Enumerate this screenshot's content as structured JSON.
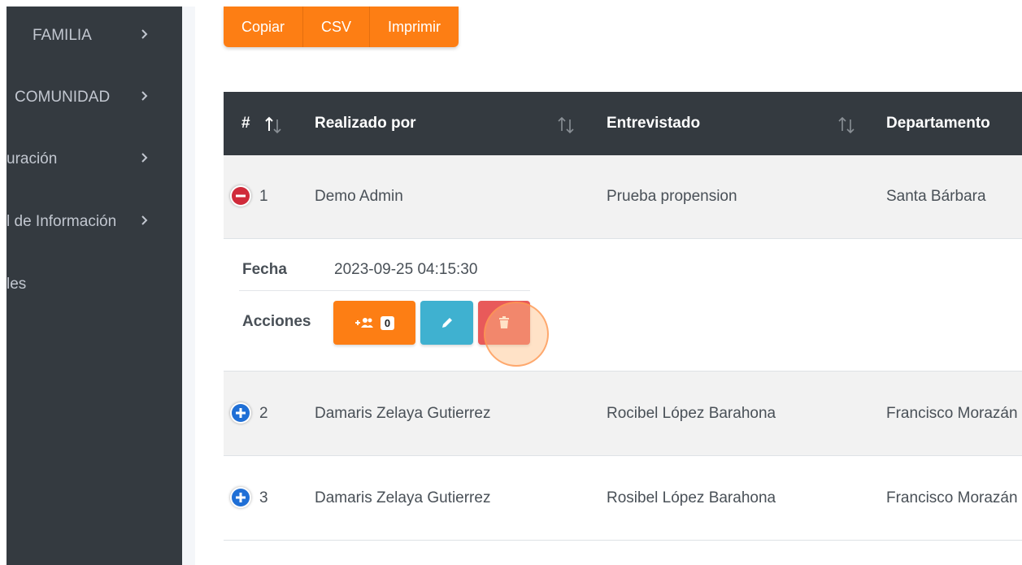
{
  "sidebar": {
    "items": [
      {
        "label": "FAMILIA"
      },
      {
        "label": "COMUNIDAD"
      },
      {
        "label": "uración"
      },
      {
        "label": "l de Información"
      },
      {
        "label": "les"
      }
    ]
  },
  "toolbar": {
    "copy_label": "Copiar",
    "csv_label": "CSV",
    "print_label": "Imprimir"
  },
  "table": {
    "headers": [
      "#",
      "Realizado por",
      "Entrevistado",
      "Departamento"
    ],
    "rows": [
      {
        "num": "1",
        "realizado_por": "Demo Admin",
        "entrevistado": "Prueba propension",
        "departamento": "Santa Bárbara"
      },
      {
        "num": "2",
        "realizado_por": "Damaris Zelaya Gutierrez",
        "entrevistado": "Rocibel López Barahona",
        "departamento": "Francisco Morazán"
      },
      {
        "num": "3",
        "realizado_por": "Damaris Zelaya Gutierrez",
        "entrevistado": "Rosibel López Barahona",
        "departamento": "Francisco Morazán"
      }
    ]
  },
  "detail": {
    "fecha_label": "Fecha",
    "fecha_value": "2023-09-25 04:15:30",
    "acciones_label": "Acciones",
    "members_count": "0"
  },
  "colors": {
    "sidebar_bg": "#343a40",
    "accent_orange": "#fd7e14",
    "info_blue": "#3fb1d0",
    "danger_red": "#e85a5a",
    "expand_blue": "#1f6fd6",
    "collapse_red": "#d02a3a"
  },
  "icons": {
    "chevron": "chevron-right-icon",
    "sort": "sort-icon",
    "add_member": "user-plus-icon",
    "edit": "pencil-icon",
    "delete": "trash-icon"
  }
}
